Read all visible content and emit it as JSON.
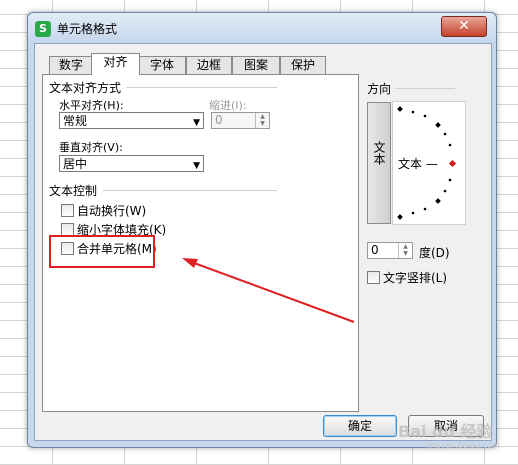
{
  "dialog": {
    "title": "单元格格式",
    "app_icon": "S",
    "close_label": "✕"
  },
  "tabs": [
    {
      "label": "数字"
    },
    {
      "label": "对齐"
    },
    {
      "label": "字体"
    },
    {
      "label": "边框"
    },
    {
      "label": "图案"
    },
    {
      "label": "保护"
    }
  ],
  "text_alignment": {
    "group_title": "文本对齐方式",
    "horizontal_label": "水平对齐(H):",
    "horizontal_value": "常规",
    "indent_label": "缩进(I):",
    "indent_value": "0",
    "vertical_label": "垂直对齐(V):",
    "vertical_value": "居中"
  },
  "text_control": {
    "group_title": "文本控制",
    "wrap_label": "自动换行(W)",
    "shrink_label": "缩小字体填充(K)",
    "merge_label": "合并单元格(M)"
  },
  "orientation": {
    "group_title": "方向",
    "vertical_text": "文本",
    "dial_text": "文本 —",
    "degree_value": "0",
    "degree_label": "度(D)",
    "vertical_layout_label": "文字竖排(L)"
  },
  "buttons": {
    "ok": "确定",
    "cancel": "取消"
  },
  "watermark": {
    "line1": "Bai du 经验",
    "line2": "jingyan.baidu.com"
  },
  "colors": {
    "annotation": "#e02020",
    "dial_center": "#d81010"
  }
}
